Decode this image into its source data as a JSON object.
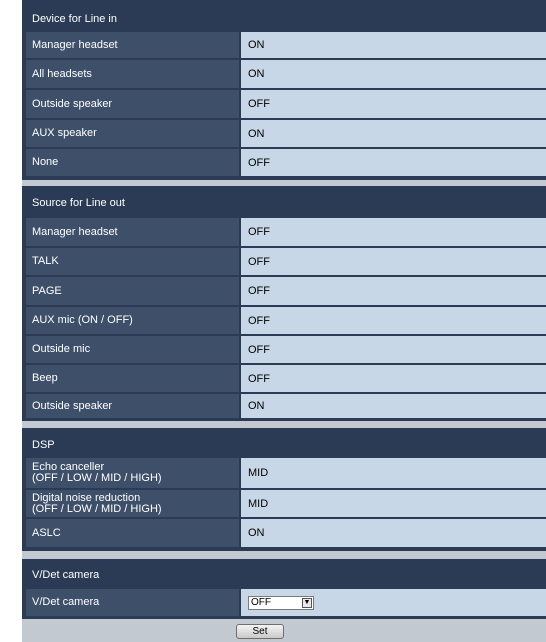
{
  "sections": {
    "line_in": {
      "title": "Device for Line in",
      "rows": [
        {
          "label": "Manager headset",
          "value": "ON"
        },
        {
          "label": "All headsets",
          "value": "ON"
        },
        {
          "label": "Outside speaker",
          "value": "OFF"
        },
        {
          "label": "AUX speaker",
          "value": "ON"
        },
        {
          "label": "None",
          "value": "OFF"
        }
      ]
    },
    "line_out": {
      "title": "Source for Line out",
      "rows": [
        {
          "label": "Manager headset",
          "value": "OFF"
        },
        {
          "label": "TALK",
          "value": "OFF"
        },
        {
          "label": "PAGE",
          "value": "OFF"
        },
        {
          "label": "AUX mic (ON / OFF)",
          "value": "OFF"
        },
        {
          "label": "Outside mic",
          "value": "OFF"
        },
        {
          "label": "Beep",
          "value": "OFF"
        },
        {
          "label": "Outside speaker",
          "value": "ON"
        }
      ]
    },
    "dsp": {
      "title": "DSP",
      "rows": [
        {
          "label_1": "Echo canceller",
          "label_2": "(OFF / LOW / MID / HIGH)",
          "value": "MID"
        },
        {
          "label_1": "Digital noise reduction",
          "label_2": "(OFF / LOW / MID / HIGH)",
          "value": "MID"
        },
        {
          "label": "ASLC",
          "value": "ON"
        }
      ]
    },
    "vdet": {
      "title": "V/Det camera",
      "label": "V/Det camera",
      "selected": "OFF"
    }
  },
  "set_label": "Set",
  "colors": {
    "panel": "#c2c9d1",
    "dark": "#2b3b55",
    "label_cell": "#3e4f69",
    "value_cell": "#c7d7e8"
  }
}
